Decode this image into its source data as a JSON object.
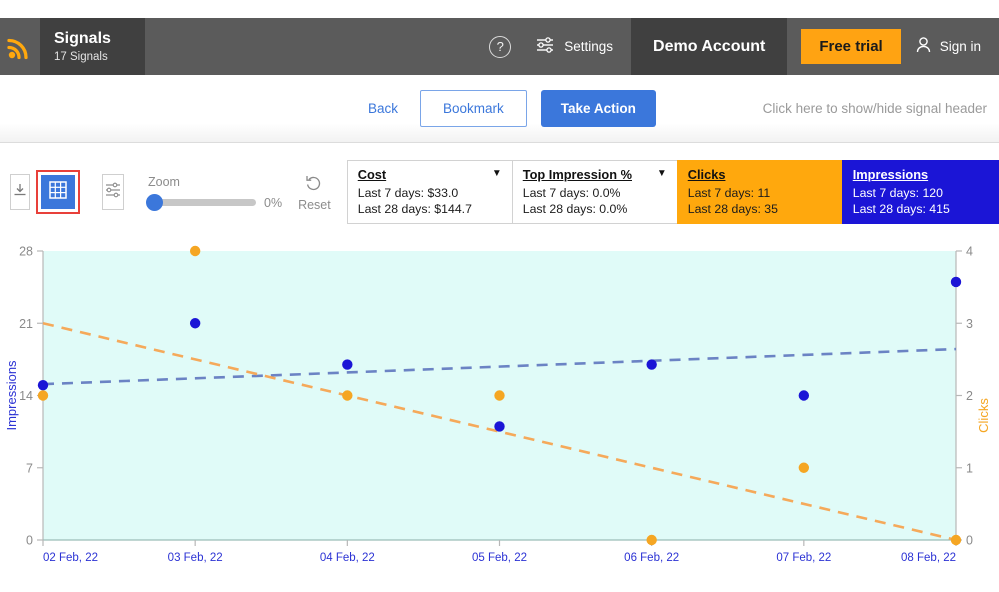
{
  "header": {
    "logo_icon": "rss-signal-icon",
    "brand_title": "Signals",
    "brand_subtitle": "17 Signals",
    "help_icon": "question-circle-icon",
    "help_label": "?",
    "settings_icon": "sliders-icon",
    "settings_label": "Settings",
    "account_label": "Demo Account",
    "trial_label": "Free trial",
    "signin_icon": "user-icon",
    "signin_label": "Sign in"
  },
  "action_row": {
    "back_label": "Back",
    "bookmark_label": "Bookmark",
    "take_action_label": "Take Action",
    "hint_text": "Click here to show/hide signal header"
  },
  "toolbar": {
    "download_icon": "download-icon",
    "grid_icon": "table-grid-icon",
    "filter_icon": "filter-sliders-icon",
    "zoom_label": "Zoom",
    "zoom_value": "0%",
    "reset_icon": "undo-icon",
    "reset_label": "Reset",
    "cards": [
      {
        "title": "Cost",
        "line1": "Last 7 days: $33.0",
        "line2": "Last 28 days: $144.7",
        "caret": "▼",
        "style": "plain"
      },
      {
        "title": "Top Impression %",
        "line1": "Last 7 days: 0.0%",
        "line2": "Last 28 days: 0.0%",
        "caret": "▼",
        "style": "plain"
      },
      {
        "title": "Clicks",
        "line1": "Last 7 days: 11",
        "line2": "Last 28 days: 35",
        "caret": "",
        "style": "orange"
      },
      {
        "title": "Impressions",
        "line1": "Last 7 days: 120",
        "line2": "Last 28 days: 415",
        "caret": "",
        "style": "blue"
      }
    ]
  },
  "colors": {
    "brand_orange": "#ffa80d",
    "impressions_blue": "#1b15d6",
    "clicks_orange": "#f5a623",
    "plot_bg": "#e0fbf8",
    "accent_blue": "#3b77db",
    "selection_red": "#e8403a"
  },
  "chart_data": {
    "type": "scatter",
    "title": "",
    "xlabel": "",
    "ylabel": "Impressions",
    "y2label": "Clicks",
    "categories": [
      "02 Feb, 22",
      "03 Feb, 22",
      "04 Feb, 22",
      "05 Feb, 22",
      "06 Feb, 22",
      "07 Feb, 22",
      "08 Feb, 22"
    ],
    "ylim": [
      0,
      28
    ],
    "yticks": [
      0,
      7,
      14,
      21,
      28
    ],
    "y2lim": [
      0,
      4
    ],
    "y2ticks": [
      0,
      1,
      2,
      3,
      4
    ],
    "grid": false,
    "legend": "none",
    "series": [
      {
        "name": "Impressions",
        "axis": "left",
        "color": "#1b15d6",
        "marker": "circle",
        "values": [
          15,
          21,
          17,
          11,
          17,
          14,
          25
        ]
      },
      {
        "name": "Clicks",
        "axis": "right",
        "color": "#f5a623",
        "marker": "circle",
        "values": [
          2,
          4,
          2,
          2,
          0,
          1,
          0
        ]
      }
    ],
    "trendlines": [
      {
        "name": "Impressions trend",
        "axis": "left",
        "color": "#6b83c4",
        "style": "dashed",
        "start": 15.1,
        "end": 18.5
      },
      {
        "name": "Clicks trend",
        "axis": "right",
        "color": "#f5a95a",
        "style": "dashed",
        "start": 3.0,
        "end": 0.0
      }
    ]
  }
}
